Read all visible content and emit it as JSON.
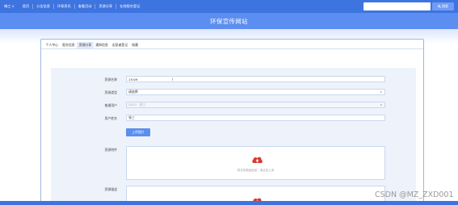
{
  "nav": {
    "user": "嗨三 ∨",
    "items": [
      "首页",
      "公告信息",
      "环保资讯",
      "查看活动",
      "资源分享",
      "在线报名登记"
    ]
  },
  "search": {
    "placeholder": "",
    "button_label": "搜索"
  },
  "site": {
    "title": "环保宣传网站"
  },
  "tabs": [
    "个人中心",
    "报名信息",
    "资源分享",
    "通知信息",
    "志愿者登记",
    "收藏"
  ],
  "active_tab_index": 2,
  "form": {
    "resource_name_label": "资源名称",
    "resource_name_value": "15:09",
    "resource_type_label": "资源类型",
    "resource_type_value": "请选择",
    "account_label": "普通用户",
    "account_value": "2023 · 张三",
    "user_name_label": "用户姓名",
    "user_name_value": "张三",
    "upload_image_button": "上传图片",
    "attachment_label": "资源附件",
    "upload_hint": "将文件拖到此处，或点击上传",
    "detail_label": "资源描述"
  },
  "watermark": "CSDN @MZ_ZXD001",
  "colors": {
    "nav": "#3e74e0",
    "banner": "#5b8ef0",
    "upload_icon": "#d9392c"
  }
}
